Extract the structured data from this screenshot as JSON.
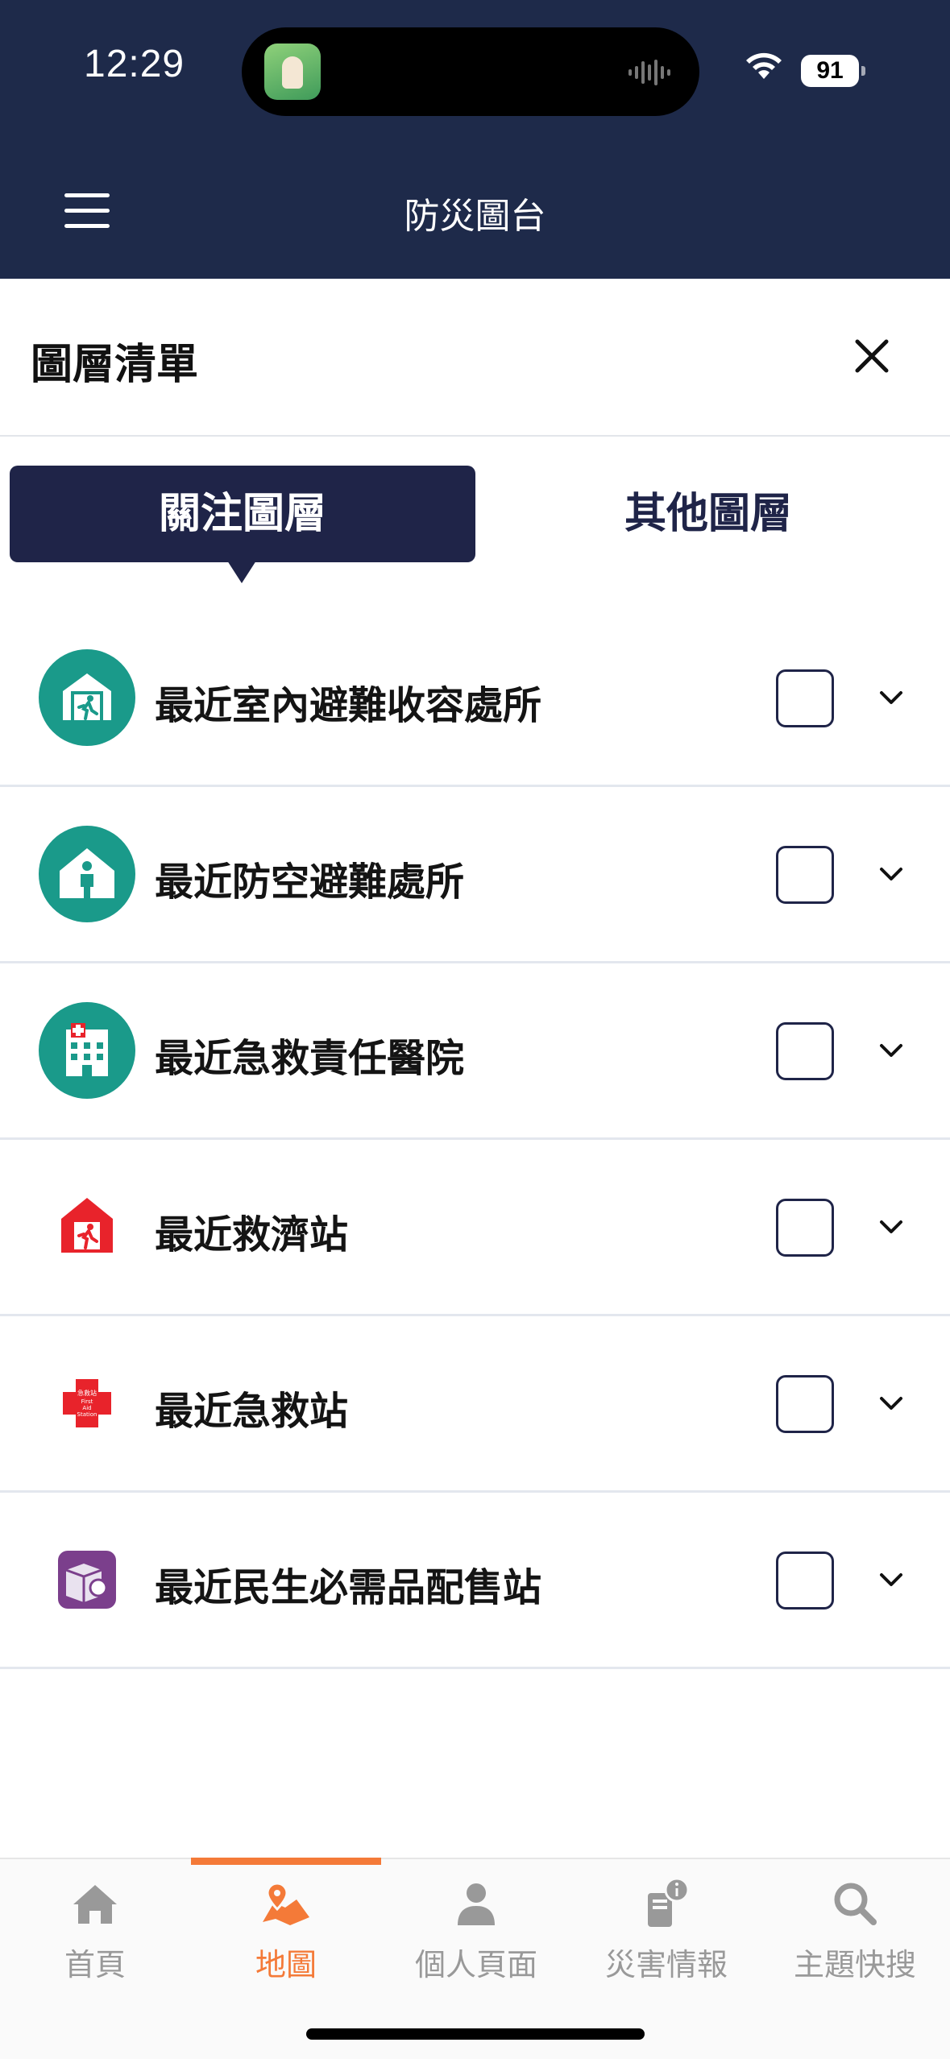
{
  "status_bar": {
    "time": "12:29",
    "battery": "91"
  },
  "header": {
    "title": "防災圖台"
  },
  "panel": {
    "title": "圖層清單"
  },
  "tabs": [
    {
      "label": "關注圖層",
      "active": true
    },
    {
      "label": "其他圖層",
      "active": false
    }
  ],
  "layers": [
    {
      "label": "最近室內避難收容處所",
      "icon": "indoor-shelter-icon",
      "checked": false
    },
    {
      "label": "最近防空避難處所",
      "icon": "air-raid-shelter-icon",
      "checked": false
    },
    {
      "label": "最近急救責任醫院",
      "icon": "hospital-icon",
      "checked": false
    },
    {
      "label": "最近救濟站",
      "icon": "relief-station-icon",
      "checked": false
    },
    {
      "label": "最近急救站",
      "icon": "first-aid-station-icon",
      "checked": false
    },
    {
      "label": "最近民生必需品配售站",
      "icon": "supplies-station-icon",
      "checked": false
    }
  ],
  "first_aid_icon_text": [
    "急救站",
    "First",
    "Aid",
    "Station"
  ],
  "bottom_nav": [
    {
      "label": "首頁",
      "icon": "home-icon",
      "active": false
    },
    {
      "label": "地圖",
      "icon": "map-icon",
      "active": true
    },
    {
      "label": "個人頁面",
      "icon": "person-icon",
      "active": false
    },
    {
      "label": "災害情報",
      "icon": "alert-info-icon",
      "active": false
    },
    {
      "label": "主題快搜",
      "icon": "search-icon",
      "active": false
    }
  ],
  "colors": {
    "header_bg": "#1e2a4a",
    "tab_active_bg": "#1f2448",
    "accent": "#f47a38",
    "icon_teal": "#1a9a8a",
    "icon_red": "#e8232b",
    "icon_purple": "#7b3f8c"
  }
}
